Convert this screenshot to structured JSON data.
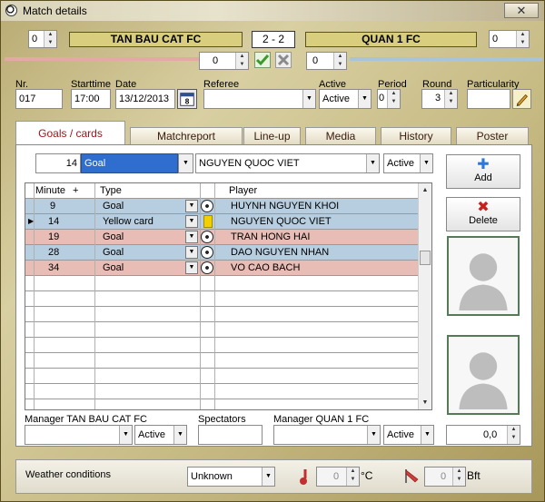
{
  "window": {
    "title": "Match details",
    "close_glyph": "✕"
  },
  "header": {
    "home_goals_input": "0",
    "home_team": "TAN BAU CAT FC",
    "score": "2 - 2",
    "away_team": "QUAN 1 FC",
    "away_goals_input": "0",
    "home_extra": "0",
    "away_extra": "0",
    "home_color": "#e3a9a4",
    "away_color": "#a8c4d8"
  },
  "match": {
    "nr_label": "Nr.",
    "nr_value": "017",
    "starttime_label": "Starttime",
    "starttime_value": "17:00",
    "date_label": "Date",
    "date_value": "13/12/2013",
    "calendar_day": "8",
    "referee_label": "Referee",
    "referee_value": "",
    "active_label": "Active",
    "active_value": "Active",
    "period_label": "Period",
    "period_value": "0",
    "round_label": "Round",
    "round_value": "3",
    "particularity_label": "Particularity",
    "particularity_value": ""
  },
  "tabs": [
    {
      "label": "Goals / cards",
      "active": true
    },
    {
      "label": "Matchreport",
      "active": false
    },
    {
      "label": "Line-up",
      "active": false
    },
    {
      "label": "Media",
      "active": false
    },
    {
      "label": "History",
      "active": false
    },
    {
      "label": "Poster",
      "active": false
    }
  ],
  "entry": {
    "minute": "14",
    "type": "Goal",
    "player": "NGUYEN QUOC VIET",
    "status": "Active"
  },
  "grid": {
    "headers": {
      "minute": "Minute",
      "plus": "+",
      "type": "Type",
      "player": "Player"
    },
    "rows": [
      {
        "minute": "9",
        "type": "Goal",
        "player": "HUYNH NGUYEN KHOI",
        "color": "blue",
        "marker": "",
        "icon": "ball"
      },
      {
        "minute": "14",
        "type": "Yellow card",
        "player": "NGUYEN QUOC VIET",
        "color": "blue",
        "marker": "▶",
        "icon": "yellow-card"
      },
      {
        "minute": "19",
        "type": "Goal",
        "player": "TRAN HONG HAI",
        "color": "pink",
        "marker": "",
        "icon": "ball"
      },
      {
        "minute": "28",
        "type": "Goal",
        "player": "DAO NGUYEN NHAN",
        "color": "blue",
        "marker": "",
        "icon": "ball"
      },
      {
        "minute": "34",
        "type": "Goal",
        "player": "VO CAO BACH",
        "color": "pink",
        "marker": "",
        "icon": "ball"
      }
    ]
  },
  "buttons": {
    "add": "Add",
    "delete": "Delete"
  },
  "managers": {
    "home_label": "Manager TAN BAU CAT FC",
    "home_value": "",
    "home_status": "Active",
    "spectators_label": "Spectators",
    "spectators_value": "",
    "away_label": "Manager QUAN 1 FC",
    "away_value": "",
    "away_status": "Active",
    "amount_value": "0,0"
  },
  "weather": {
    "label": "Weather conditions",
    "condition": "Unknown",
    "temperature": "0",
    "temperature_unit": "°C",
    "wind": "0",
    "wind_unit": "Bft"
  }
}
